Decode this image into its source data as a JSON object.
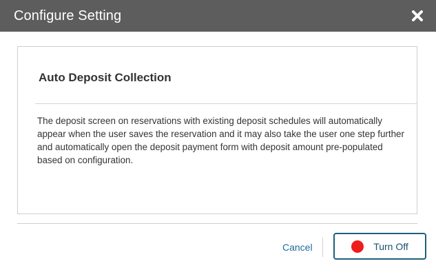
{
  "dialog": {
    "title": "Configure Setting",
    "close_icon": "close-icon"
  },
  "setting": {
    "heading": "Auto Deposit Collection",
    "description": "The deposit screen on reservations with existing deposit schedules will automatically appear when the user saves the reservation and it may also take the user one step further and automatically open the deposit payment form with deposit amount pre-populated based on configuration."
  },
  "footer": {
    "cancel_label": "Cancel",
    "turn_off_label": "Turn Off",
    "status_icon": "red-dot-icon"
  },
  "colors": {
    "titlebar": "#5d5d5d",
    "accent": "#1e5f7a",
    "link": "#1a6c9e",
    "status_off": "#ee1c1c"
  }
}
